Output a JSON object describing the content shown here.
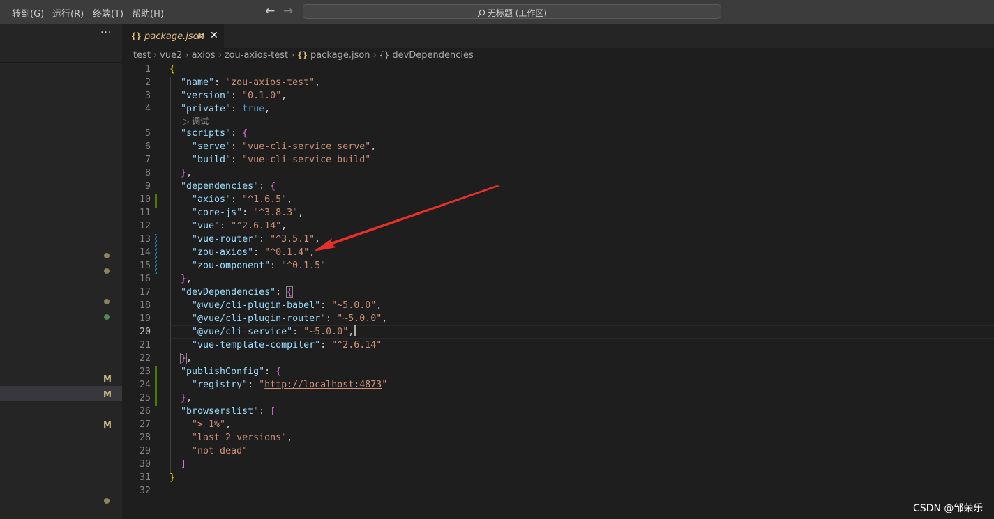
{
  "menu": [
    {
      "label": "转到(G)"
    },
    {
      "label": "运行(R)"
    },
    {
      "label": "终端(T)"
    },
    {
      "label": "帮助(H)"
    }
  ],
  "search": {
    "text": "无标题 (工作区)"
  },
  "sidebar": {
    "more_label": "···",
    "badges": [
      "M",
      "M",
      "M"
    ]
  },
  "tab": {
    "title": "package.json",
    "status": "M",
    "icon": "{}"
  },
  "breadcrumb": {
    "items": [
      "test",
      "vue2",
      "axios",
      "zou-axios-test",
      "package.json",
      "devDependencies"
    ],
    "json_icon": "{}",
    "object_icon": "{}"
  },
  "codelens": {
    "label": "调试"
  },
  "code_lines": [
    {
      "num": "1"
    },
    {
      "num": "2"
    },
    {
      "num": "3"
    },
    {
      "num": "4"
    },
    {
      "num": "5"
    },
    {
      "num": "6"
    },
    {
      "num": "7"
    },
    {
      "num": "8"
    },
    {
      "num": "9"
    },
    {
      "num": "10"
    },
    {
      "num": "11"
    },
    {
      "num": "12"
    },
    {
      "num": "13"
    },
    {
      "num": "14"
    },
    {
      "num": "15"
    },
    {
      "num": "16"
    },
    {
      "num": "17"
    },
    {
      "num": "18"
    },
    {
      "num": "19"
    },
    {
      "num": "20"
    },
    {
      "num": "21"
    },
    {
      "num": "22"
    },
    {
      "num": "23"
    },
    {
      "num": "24"
    },
    {
      "num": "25"
    },
    {
      "num": "26"
    },
    {
      "num": "27"
    },
    {
      "num": "28"
    },
    {
      "num": "29"
    },
    {
      "num": "30"
    },
    {
      "num": "31"
    },
    {
      "num": "32"
    }
  ],
  "code": {
    "k_name": "\"name\"",
    "v_name": "\"zou-axios-test\"",
    "k_version": "\"version\"",
    "v_version": "\"0.1.0\"",
    "k_private": "\"private\"",
    "v_private": "true",
    "k_scripts": "\"scripts\"",
    "k_serve": "\"serve\"",
    "v_serve": "\"vue-cli-service serve\"",
    "k_build": "\"build\"",
    "v_build": "\"vue-cli-service build\"",
    "k_dependencies": "\"dependencies\"",
    "k_axios": "\"axios\"",
    "v_axios": "\"^1.6.5\"",
    "k_corejs": "\"core-js\"",
    "v_corejs": "\"^3.8.3\"",
    "k_vue": "\"vue\"",
    "v_vue": "\"^2.6.14\"",
    "k_vuerouter": "\"vue-router\"",
    "v_vuerouter": "\"^3.5.1\"",
    "k_zouaxios": "\"zou-axios\"",
    "v_zouaxios": "\"^0.1.4\"",
    "k_zouomponent": "\"zou-omponent\"",
    "v_zouomponent": "\"^0.1.5\"",
    "k_devdependencies": "\"devDependencies\"",
    "k_babel": "\"@vue/cli-plugin-babel\"",
    "v_babel": "\"~5.0.0\"",
    "k_router": "\"@vue/cli-plugin-router\"",
    "v_router": "\"~5.0.0\"",
    "k_cliservice": "\"@vue/cli-service\"",
    "v_cliservice": "\"~5.0.0\"",
    "k_template": "\"vue-template-compiler\"",
    "v_template": "\"^2.6.14\"",
    "k_publish": "\"publishConfig\"",
    "k_registry": "\"registry\"",
    "v_registry_q1": "\"",
    "v_registry_url": "http://localhost:4873",
    "v_registry_q2": "\"",
    "k_browserslist": "\"browserslist\"",
    "v_b1": "\"> 1%\"",
    "v_b2": "\"last 2 versions\"",
    "v_b3": "\"not dead\""
  },
  "watermark": {
    "text": "CSDN @邹荣乐"
  },
  "colors": {
    "annotation_arrow": "#e8302a",
    "accent": "#e2c08d",
    "modified_gutter": "#1b81a8",
    "added_gutter": "#487e02"
  }
}
